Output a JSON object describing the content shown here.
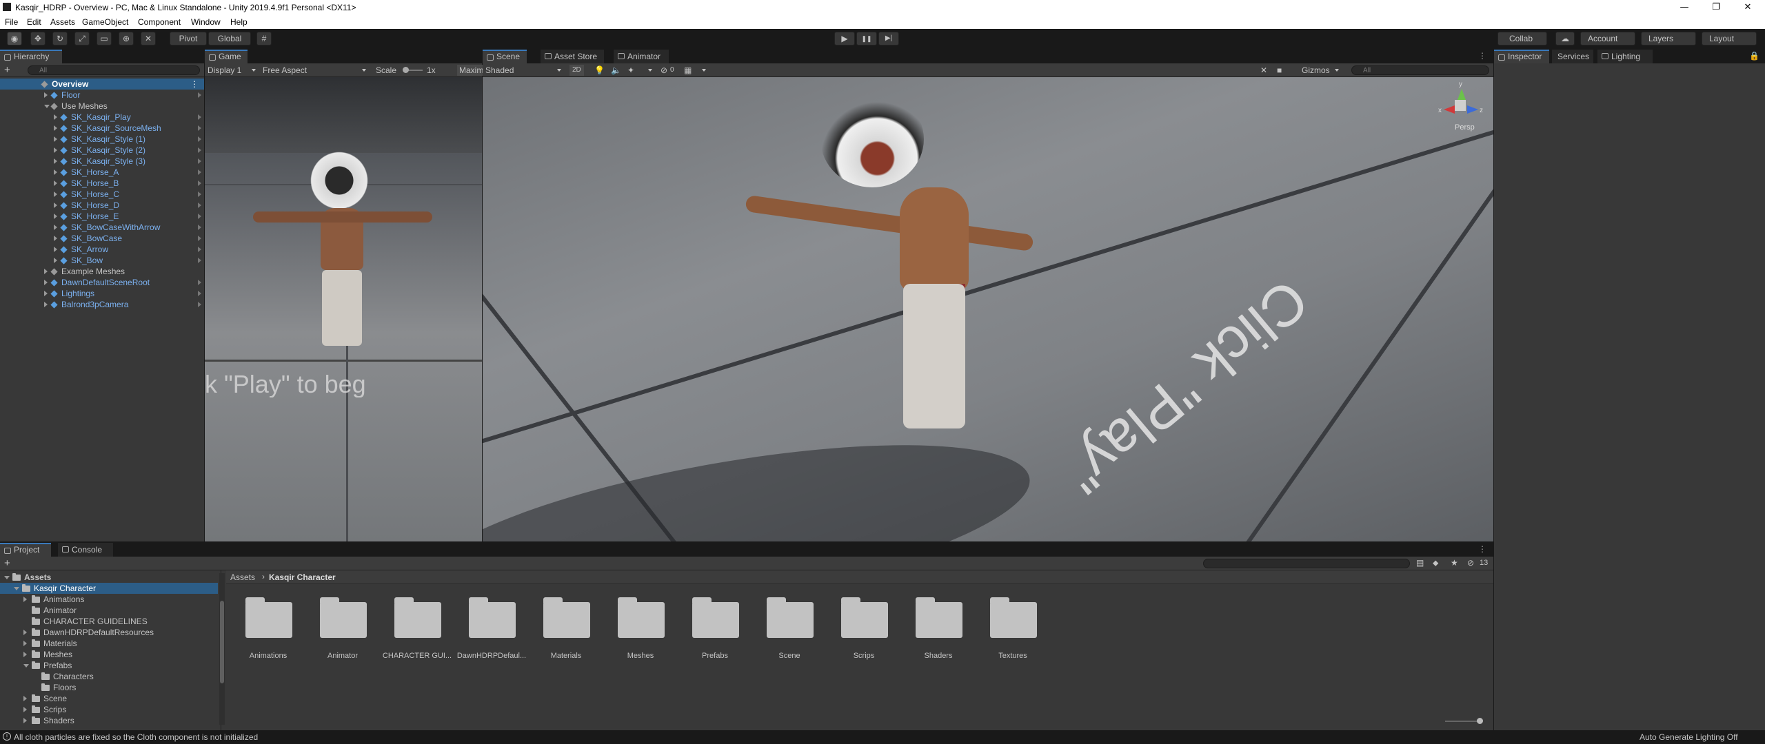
{
  "window": {
    "title": "Kasqir_HDRP - Overview - PC, Mac & Linux Standalone - Unity 2019.4.9f1 Personal <DX11>",
    "minimize": "—",
    "maximize": "❐",
    "close": "✕"
  },
  "menu": [
    "File",
    "Edit",
    "Assets",
    "GameObject",
    "Component",
    "Window",
    "Help"
  ],
  "toolbar": {
    "pivot": "Pivot",
    "global": "Global",
    "play": "▶",
    "pause": "❚❚",
    "step": "▶|",
    "collab": "Collab",
    "account": "Account",
    "layers": "Layers",
    "layout": "Layout"
  },
  "hierarchy": {
    "tab": "Hierarchy",
    "search_placeholder": "All",
    "items": [
      {
        "label": "Overview",
        "depth": 0,
        "type": "scene",
        "selected": true
      },
      {
        "label": "Floor",
        "depth": 1,
        "type": "prefab",
        "expand": "right"
      },
      {
        "label": "Use Meshes",
        "depth": 1,
        "type": "object",
        "expand": "down"
      },
      {
        "label": "SK_Kasqir_Play",
        "depth": 2,
        "type": "prefab",
        "expand": "right"
      },
      {
        "label": "SK_Kasqir_SourceMesh",
        "depth": 2,
        "type": "prefab",
        "expand": "right"
      },
      {
        "label": "SK_Kasqir_Style (1)",
        "depth": 2,
        "type": "prefab",
        "expand": "right"
      },
      {
        "label": "SK_Kasqir_Style (2)",
        "depth": 2,
        "type": "prefab",
        "expand": "right"
      },
      {
        "label": "SK_Kasqir_Style (3)",
        "depth": 2,
        "type": "prefab",
        "expand": "right"
      },
      {
        "label": "SK_Horse_A",
        "depth": 2,
        "type": "prefab",
        "expand": "right"
      },
      {
        "label": "SK_Horse_B",
        "depth": 2,
        "type": "prefab",
        "expand": "right"
      },
      {
        "label": "SK_Horse_C",
        "depth": 2,
        "type": "prefab",
        "expand": "right"
      },
      {
        "label": "SK_Horse_D",
        "depth": 2,
        "type": "prefab",
        "expand": "right"
      },
      {
        "label": "SK_Horse_E",
        "depth": 2,
        "type": "prefab",
        "expand": "right"
      },
      {
        "label": "SK_BowCaseWithArrow",
        "depth": 2,
        "type": "prefab",
        "expand": "right"
      },
      {
        "label": "SK_BowCase",
        "depth": 2,
        "type": "prefab",
        "expand": "right"
      },
      {
        "label": "SK_Arrow",
        "depth": 2,
        "type": "prefab",
        "expand": "right"
      },
      {
        "label": "SK_Bow",
        "depth": 2,
        "type": "prefab",
        "expand": "right"
      },
      {
        "label": "Example Meshes",
        "depth": 1,
        "type": "object",
        "expand": "right"
      },
      {
        "label": "DawnDefaultSceneRoot",
        "depth": 1,
        "type": "prefab",
        "expand": "right"
      },
      {
        "label": "Lightings",
        "depth": 1,
        "type": "prefab",
        "expand": "right"
      },
      {
        "label": "Balrond3pCamera",
        "depth": 1,
        "type": "prefab",
        "expand": "right"
      }
    ]
  },
  "game": {
    "tab": "Game",
    "display": "Display 1",
    "aspect": "Free Aspect",
    "scale_label": "Scale",
    "scale_value": "1x",
    "maximize": "Maxim",
    "overlay_text": "k \"Play\" to beg"
  },
  "scene": {
    "tabs": [
      "Scene",
      "Asset Store",
      "Animator"
    ],
    "shading": "Shaded",
    "mode2d": "2D",
    "hidden_count": "0",
    "gizmos": "Gizmos",
    "search_placeholder": "All",
    "persp": "Persp",
    "axis_y": "y",
    "axis_x": "x",
    "axis_z": "z",
    "overlay_text": "Click \"Play\""
  },
  "inspector": {
    "tabs": [
      "Inspector",
      "Services",
      "Lighting"
    ]
  },
  "project": {
    "tabs": [
      "Project",
      "Console"
    ],
    "hidden_count": "13",
    "tree": [
      {
        "label": "Assets",
        "depth": 0,
        "expand": "down",
        "bold": true
      },
      {
        "label": "Kasqir Character",
        "depth": 1,
        "expand": "down",
        "selected": true
      },
      {
        "label": "Animations",
        "depth": 2,
        "expand": "right"
      },
      {
        "label": "Animator",
        "depth": 2,
        "expand": ""
      },
      {
        "label": "CHARACTER GUIDELINES",
        "depth": 2,
        "expand": ""
      },
      {
        "label": "DawnHDRPDefaultResources",
        "depth": 2,
        "expand": "right"
      },
      {
        "label": "Materials",
        "depth": 2,
        "expand": "right"
      },
      {
        "label": "Meshes",
        "depth": 2,
        "expand": "right"
      },
      {
        "label": "Prefabs",
        "depth": 2,
        "expand": "down"
      },
      {
        "label": "Characters",
        "depth": 3,
        "expand": ""
      },
      {
        "label": "Floors",
        "depth": 3,
        "expand": ""
      },
      {
        "label": "Scene",
        "depth": 2,
        "expand": "right"
      },
      {
        "label": "Scrips",
        "depth": 2,
        "expand": "right"
      },
      {
        "label": "Shaders",
        "depth": 2,
        "expand": "right"
      }
    ],
    "breadcrumb": [
      "Assets",
      "Kasqir Character"
    ],
    "breadcrumb_sep": "›",
    "folders": [
      "Animations",
      "Animator",
      "CHARACTER GUI...",
      "DawnHDRPDefaul...",
      "Materials",
      "Meshes",
      "Prefabs",
      "Scene",
      "Scrips",
      "Shaders",
      "Textures"
    ]
  },
  "status": {
    "message": "All cloth particles are fixed so the Cloth component is not initialized",
    "right": "Auto Generate Lighting Off"
  },
  "colors": {
    "accent": "#3a79bb",
    "prefab_text": "#7bb0ee",
    "selection": "#2c5d87",
    "panel": "#383838"
  }
}
